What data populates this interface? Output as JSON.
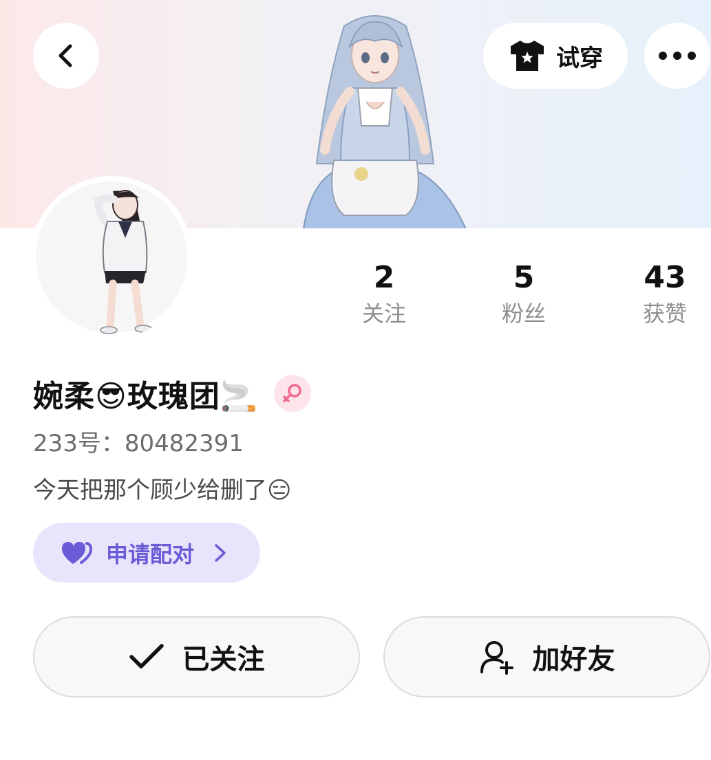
{
  "header": {
    "back_icon": "chevron-left-icon",
    "tryon_label": "试穿",
    "tryon_icon": "tshirt-icon",
    "more_icon": "more-dots-icon"
  },
  "stats": [
    {
      "value": "2",
      "label": "关注"
    },
    {
      "value": "5",
      "label": "粉丝"
    },
    {
      "value": "43",
      "label": "获赞"
    }
  ],
  "profile": {
    "name": "婉柔😎玫瑰团🚬",
    "gender_icon": "female-icon",
    "uid_text": "233号：80482391",
    "bio": "今天把那个顾少给删了😑"
  },
  "match": {
    "label": "申请配对",
    "icon": "heart-icon",
    "accent": "#6a5bd6"
  },
  "actions": {
    "follow_label": "已关注",
    "add_friend_label": "加好友"
  },
  "colors": {
    "gender_badge": "#fde4ea",
    "match_bg": "#e8e4fb"
  }
}
